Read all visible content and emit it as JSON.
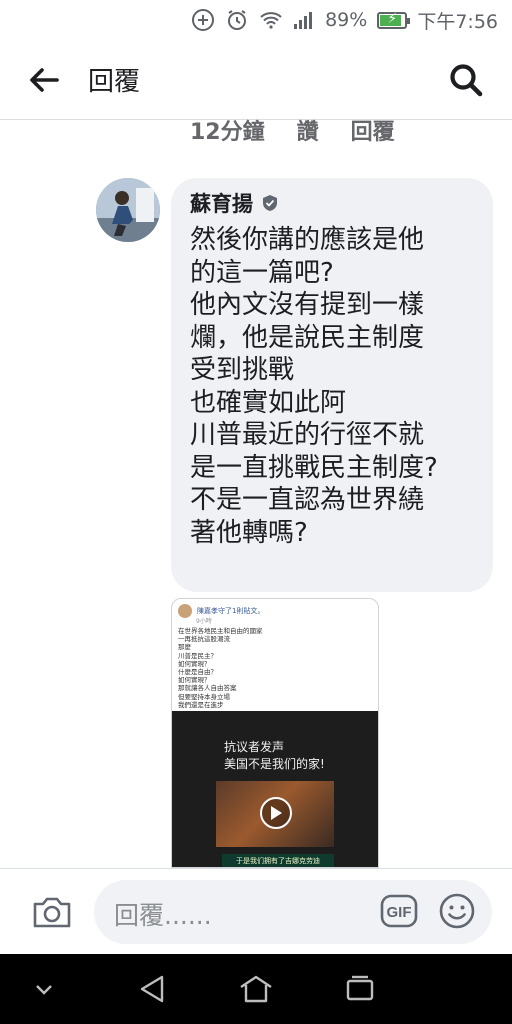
{
  "status_bar": {
    "battery_percent": "89%",
    "battery_level": 0.89,
    "time": "下午7:56",
    "icons": [
      "add-circle-icon",
      "alarm-icon",
      "wifi-icon",
      "signal-icon",
      "battery-icon"
    ]
  },
  "header": {
    "title": "回覆",
    "back_icon": "arrow-left-icon",
    "search_icon": "search-icon"
  },
  "previous_meta": {
    "time": "12分鐘",
    "like": "讚",
    "reply": "回覆"
  },
  "comment": {
    "author": "蘇育揚",
    "lines": [
      "然後你講的應該是他",
      "的這一篇吧?",
      "他內文沒有提到一樣",
      "爛，他是說民主制度",
      "受到挑戰",
      "也確實如此阿",
      "川普最近的行徑不就",
      "是一直挑戰民主制度?",
      "不是一直認為世界繞",
      "著他轉嗎?"
    ]
  },
  "shared_post": {
    "author": "陳嘉孝守了1則貼文。",
    "time": "9小時",
    "text_lines": [
      "在世界各地民主和自由的國家",
      "一再抵抗這股潮流",
      "那麼",
      "川普是民主？",
      "如何實現？",
      "什麼是自由？",
      "如何實現？",
      "那就讓各人自由答案",
      "但要堅持本身立場",
      "我們還是在進步"
    ],
    "video_caption_1": "抗议者发声",
    "video_caption_2": "美国不是我们的家!",
    "video_subtitle": "于是我们拥有了吉娜克劳迪"
  },
  "composer": {
    "placeholder": "回覆......",
    "gif_label": "GIF"
  },
  "nav_bar": {
    "icons": [
      "chevron-down-icon",
      "back-triangle-icon",
      "home-icon",
      "recents-icon"
    ]
  },
  "colors": {
    "accent": "#1c1e21",
    "bubble": "#eff1f4",
    "meta": "#65676b",
    "battery": "#4caf50"
  }
}
